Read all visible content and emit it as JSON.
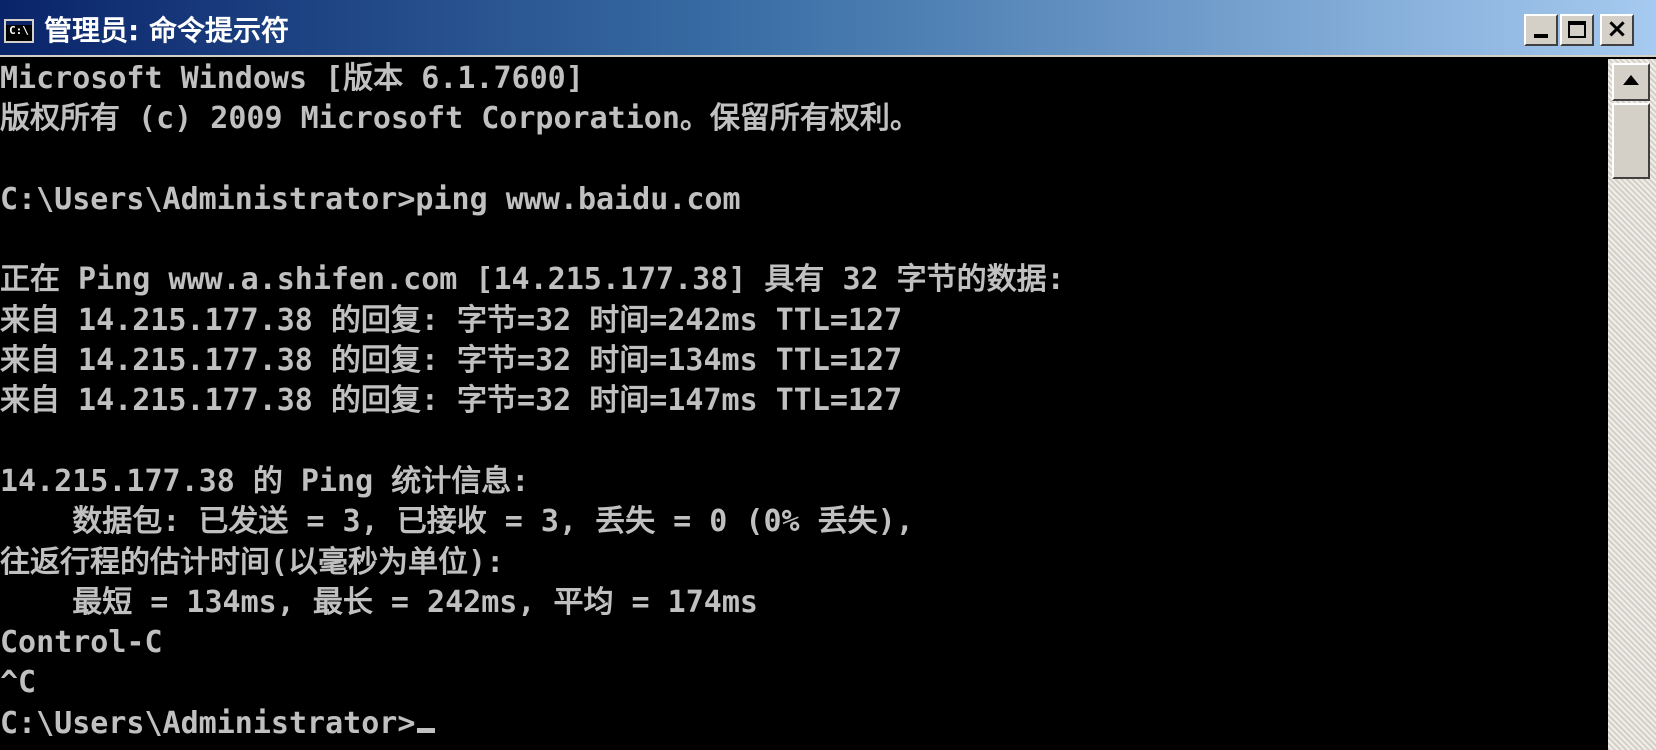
{
  "window": {
    "title": "管理员: 命令提示符",
    "icon_label": "C:\\",
    "icon": "console-icon",
    "controls": {
      "minimize": "minimize-icon",
      "maximize": "maximize-icon",
      "close": "×"
    }
  },
  "console": {
    "lines": [
      "Microsoft Windows [版本 6.1.7600]",
      "版权所有 (c) 2009 Microsoft Corporation。保留所有权利。",
      "",
      "C:\\Users\\Administrator>ping www.baidu.com",
      "",
      "正在 Ping www.a.shifen.com [14.215.177.38] 具有 32 字节的数据:",
      "来自 14.215.177.38 的回复: 字节=32 时间=242ms TTL=127",
      "来自 14.215.177.38 的回复: 字节=32 时间=134ms TTL=127",
      "来自 14.215.177.38 的回复: 字节=32 时间=147ms TTL=127",
      "",
      "14.215.177.38 的 Ping 统计信息:",
      "    数据包: 已发送 = 3, 已接收 = 3, 丢失 = 0 (0% 丢失),",
      "往返行程的估计时间(以毫秒为单位):",
      "    最短 = 134ms, 最长 = 242ms, 平均 = 174ms",
      "Control-C",
      "^C"
    ],
    "prompt": "C:\\Users\\Administrator>"
  },
  "colors": {
    "background": "#000000",
    "text": "#c0c0c0",
    "titlebar_start": "#0a246a",
    "titlebar_end": "#a6caf0"
  }
}
